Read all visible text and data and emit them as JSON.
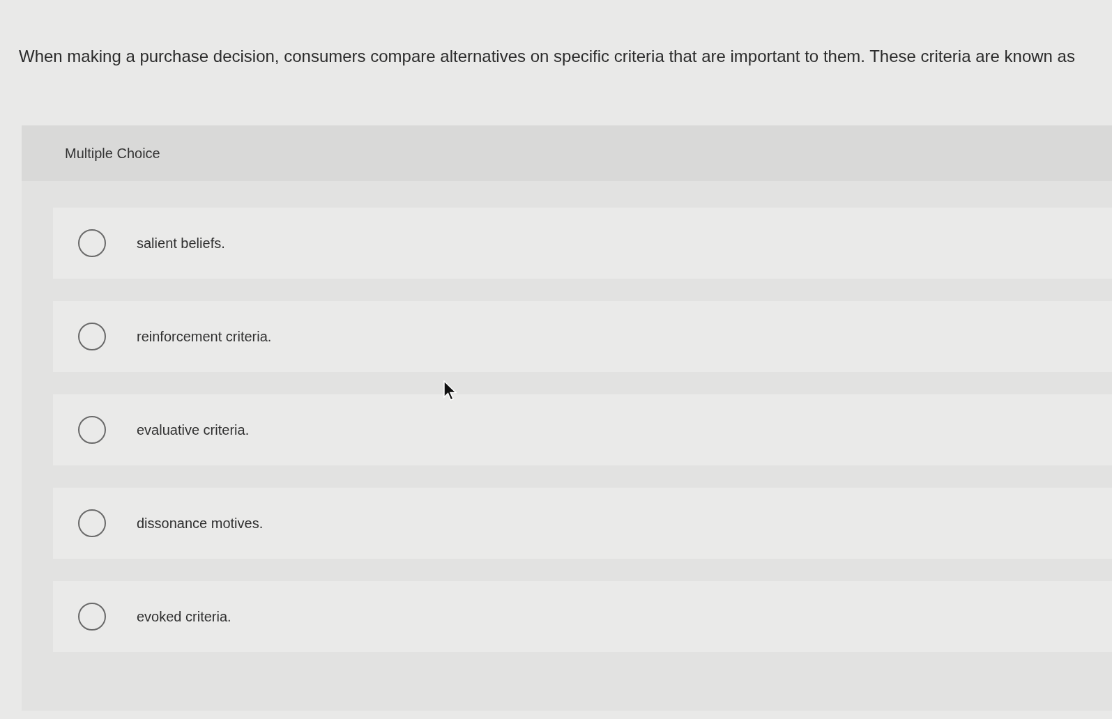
{
  "question": {
    "text": "When making a purchase decision, consumers compare alternatives on specific criteria that are important to them. These criteria are known as"
  },
  "panel": {
    "title": "Multiple Choice"
  },
  "options": [
    {
      "label": "salient beliefs.",
      "selected": false
    },
    {
      "label": "reinforcement criteria.",
      "selected": false
    },
    {
      "label": "evaluative criteria.",
      "selected": false
    },
    {
      "label": "dissonance motives.",
      "selected": false
    },
    {
      "label": "evoked criteria.",
      "selected": false
    }
  ]
}
